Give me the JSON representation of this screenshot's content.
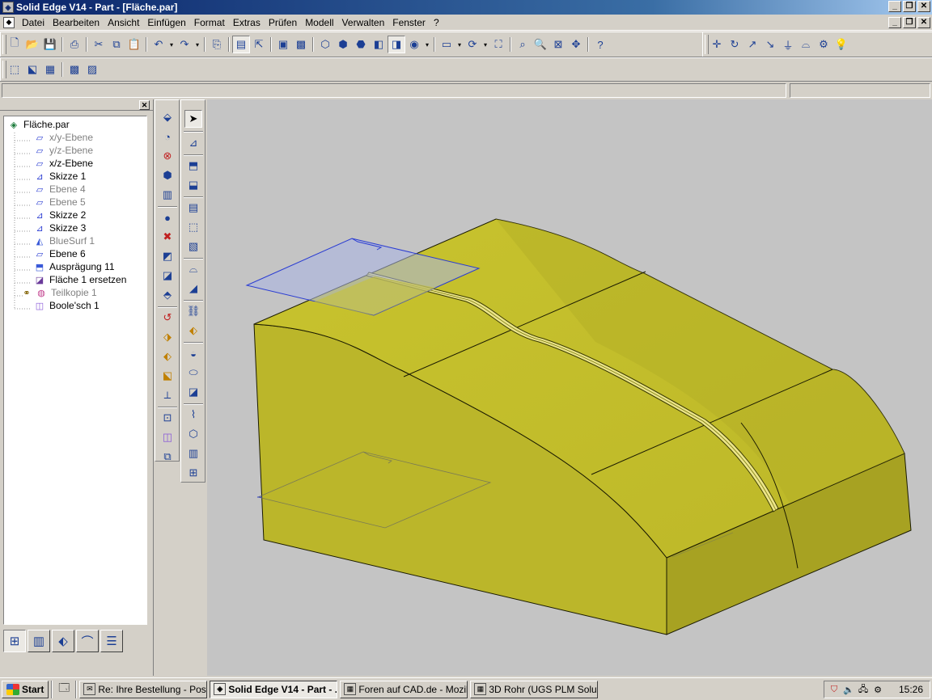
{
  "window": {
    "title": "Solid Edge V14 - Part - [Fläche.par]",
    "minimize": "_",
    "maximize": "❐",
    "close": "✕"
  },
  "menu": {
    "items": [
      "Datei",
      "Bearbeiten",
      "Ansicht",
      "Einfügen",
      "Format",
      "Extras",
      "Prüfen",
      "Modell",
      "Verwalten",
      "Fenster",
      "?"
    ]
  },
  "edgebar": {
    "close": "✕",
    "tree": [
      {
        "label": "Fläche.par",
        "icon": "part-file-icon",
        "dim": false
      },
      {
        "label": "x/y-Ebene",
        "icon": "plane-icon",
        "dim": true
      },
      {
        "label": "y/z-Ebene",
        "icon": "plane-icon",
        "dim": true
      },
      {
        "label": "x/z-Ebene",
        "icon": "plane-icon",
        "dim": false
      },
      {
        "label": "Skizze 1",
        "icon": "sketch-icon",
        "dim": false
      },
      {
        "label": "Ebene 4",
        "icon": "plane-icon",
        "dim": true
      },
      {
        "label": "Ebene 5",
        "icon": "plane-icon",
        "dim": true
      },
      {
        "label": "Skizze 2",
        "icon": "sketch-icon",
        "dim": false
      },
      {
        "label": "Skizze 3",
        "icon": "sketch-icon",
        "dim": false
      },
      {
        "label": "BlueSurf 1",
        "icon": "bluesurf-icon",
        "dim": true
      },
      {
        "label": "Ebene 6",
        "icon": "plane-icon",
        "dim": false
      },
      {
        "label": "Ausprägung 11",
        "icon": "protrusion-icon",
        "dim": false
      },
      {
        "label": "Fläche 1 ersetzen",
        "icon": "replace-face-icon",
        "dim": false
      },
      {
        "label": "Teilkopie 1",
        "icon": "part-copy-icon",
        "dim": true
      },
      {
        "label": "Boole'sch 1",
        "icon": "boolean-icon",
        "dim": false
      }
    ]
  },
  "taskbar": {
    "start": "Start",
    "tasks": [
      {
        "label": "Re: Ihre Bestellung - Post...",
        "active": false
      },
      {
        "label": "Solid Edge V14 - Part - ...",
        "active": true
      },
      {
        "label": "Foren auf CAD.de - Mozilla",
        "active": false
      },
      {
        "label": "3D Rohr (UGS PLM Solutio...",
        "active": false
      }
    ],
    "clock": "15:26"
  },
  "colors": {
    "model_face": "#c4bf2a",
    "model_front": "#b9b42a",
    "model_side": "#a8a322",
    "viewport_bg": "#c4c4c4",
    "plane_fill": "#aab4e6",
    "plane_edge": "#2a3cd2"
  }
}
